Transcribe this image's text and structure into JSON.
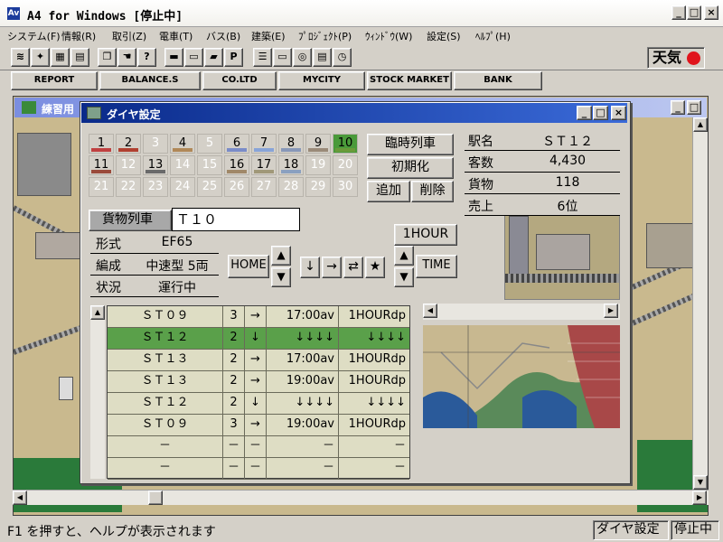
{
  "app": {
    "title": "A4 for Windows [停止中]",
    "icon": "Av"
  },
  "menu": [
    "システム(F)",
    "情報(R)",
    "取引(Z)",
    "電車(T)",
    "バス(B)",
    "建築(E)",
    "ﾌﾟﾛｼﾞｪｸﾄ(P)",
    "ｳｨﾝﾄﾞｳ(W)",
    "設定(S)",
    "ﾍﾙﾌﾟ(H)"
  ],
  "toolbar": {
    "parking_label": "P",
    "help_label": "?"
  },
  "weather": {
    "label": "天気",
    "status_color": "#e0141c"
  },
  "reports": [
    "REPORT",
    "BALANCE.S",
    "CO.LTD",
    "MYCITY",
    "STOCK MARKET",
    "BANK"
  ],
  "practice_window": {
    "title": "練習用"
  },
  "dia": {
    "title": "ダイヤ設定",
    "trains": [
      {
        "n": "1",
        "color": "#c04040",
        "enabled": true
      },
      {
        "n": "2",
        "color": "#b04030",
        "enabled": true
      },
      {
        "n": "3",
        "color": "",
        "enabled": false
      },
      {
        "n": "4",
        "color": "#b08858",
        "enabled": true
      },
      {
        "n": "5",
        "color": "",
        "enabled": false
      },
      {
        "n": "6",
        "color": "#7a8cc8",
        "enabled": true
      },
      {
        "n": "7",
        "color": "#88a4d8",
        "enabled": true
      },
      {
        "n": "8",
        "color": "#8898b8",
        "enabled": true
      },
      {
        "n": "9",
        "color": "#9a8a78",
        "enabled": true
      },
      {
        "n": "10",
        "color": "#6a9a3a",
        "enabled": true,
        "selected": true
      },
      {
        "n": "11",
        "color": "#9a4a3a",
        "enabled": true
      },
      {
        "n": "12",
        "color": "",
        "enabled": false
      },
      {
        "n": "13",
        "color": "#6a6a6a",
        "enabled": true
      },
      {
        "n": "14",
        "color": "",
        "enabled": false
      },
      {
        "n": "15",
        "color": "",
        "enabled": false
      },
      {
        "n": "16",
        "color": "#a08868",
        "enabled": true
      },
      {
        "n": "17",
        "color": "#a09878",
        "enabled": true
      },
      {
        "n": "18",
        "color": "#8aa0c0",
        "enabled": true
      },
      {
        "n": "19",
        "color": "",
        "enabled": false
      },
      {
        "n": "20",
        "color": "",
        "enabled": false
      },
      {
        "n": "21",
        "color": "",
        "enabled": false
      },
      {
        "n": "22",
        "color": "",
        "enabled": false
      },
      {
        "n": "23",
        "color": "",
        "enabled": false
      },
      {
        "n": "24",
        "color": "",
        "enabled": false
      },
      {
        "n": "25",
        "color": "",
        "enabled": false
      },
      {
        "n": "26",
        "color": "",
        "enabled": false
      },
      {
        "n": "27",
        "color": "",
        "enabled": false
      },
      {
        "n": "28",
        "color": "",
        "enabled": false
      },
      {
        "n": "29",
        "color": "",
        "enabled": false
      },
      {
        "n": "30",
        "color": "",
        "enabled": false
      }
    ],
    "buttons": {
      "extra_train": "臨時列車",
      "initialize": "初期化",
      "add": "追加",
      "delete": "削除",
      "home": "HOME",
      "time": "TIME",
      "hour": "1HOUR"
    },
    "station_info": [
      {
        "label": "駅名",
        "value": "ＳＴ１２"
      },
      {
        "label": "客数",
        "value": "4,430"
      },
      {
        "label": "貨物",
        "value": "118"
      },
      {
        "label": "売上",
        "value": "6位"
      }
    ],
    "train": {
      "kind_label": "貨物列車",
      "name": "Ｔ１０",
      "details": [
        {
          "label": "形式",
          "value": "EF65"
        },
        {
          "label": "編成",
          "value": "中速型 5両"
        },
        {
          "label": "状況",
          "value": "運行中"
        }
      ]
    },
    "route_buttons": [
      "↓",
      "→",
      "⇄",
      "★"
    ],
    "schedule": [
      {
        "station": "ＳＴ０９",
        "track": "3",
        "dir": "→",
        "arr": "17:00av",
        "dep": "1HOURdp",
        "selected": false
      },
      {
        "station": "ＳＴ１２",
        "track": "2",
        "dir": "↓",
        "arr": "↓↓↓↓",
        "dep": "↓↓↓↓",
        "selected": true
      },
      {
        "station": "ＳＴ１３",
        "track": "2",
        "dir": "→",
        "arr": "17:00av",
        "dep": "1HOURdp",
        "selected": false
      },
      {
        "station": "ＳＴ１３",
        "track": "2",
        "dir": "→",
        "arr": "19:00av",
        "dep": "1HOURdp",
        "selected": false
      },
      {
        "station": "ＳＴ１２",
        "track": "2",
        "dir": "↓",
        "arr": "↓↓↓↓",
        "dep": "↓↓↓↓",
        "selected": false
      },
      {
        "station": "ＳＴ０９",
        "track": "3",
        "dir": "→",
        "arr": "19:00av",
        "dep": "1HOURdp",
        "selected": false
      },
      {
        "station": "－",
        "track": "－",
        "dir": "－",
        "arr": "－",
        "dep": "－",
        "selected": false
      },
      {
        "station": "－",
        "track": "－",
        "dir": "－",
        "arr": "－",
        "dep": "－",
        "selected": false
      }
    ]
  },
  "status": {
    "help_text": "F1 を押すと、ヘルプが表示されます",
    "panel1": "ダイヤ設定",
    "panel2": "停止中"
  }
}
